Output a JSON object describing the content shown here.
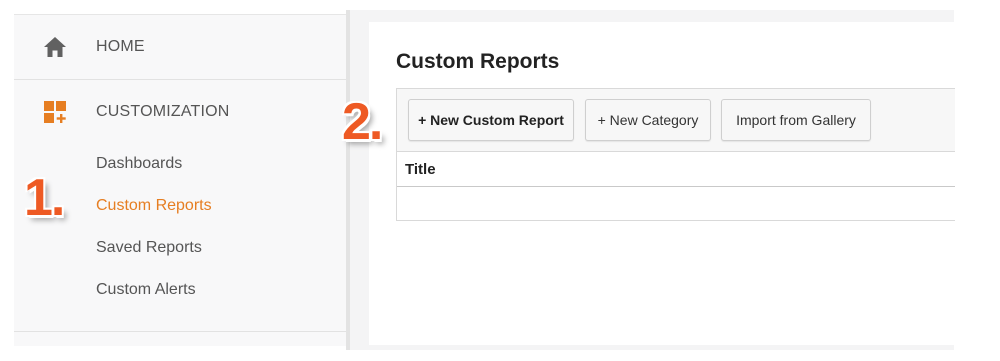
{
  "sidebar": {
    "home_label": "HOME",
    "section_label": "CUSTOMIZATION",
    "items": [
      {
        "label": "Dashboards",
        "active": false
      },
      {
        "label": "Custom Reports",
        "active": true
      },
      {
        "label": "Saved Reports",
        "active": false
      },
      {
        "label": "Custom Alerts",
        "active": false
      }
    ]
  },
  "main": {
    "title": "Custom Reports",
    "toolbar": {
      "new_report": "+ New Custom Report",
      "new_category": "+ New Category",
      "import": "Import from Gallery"
    },
    "table": {
      "columns": [
        "Title"
      ]
    }
  },
  "annotations": {
    "step1": "1.",
    "step2": "2."
  },
  "colors": {
    "accent": "#e67e22",
    "step_marker": "#ee5a24",
    "icon_grey": "#616161"
  },
  "icons": {
    "home": "home-icon",
    "customization": "dashboard-add-icon"
  }
}
